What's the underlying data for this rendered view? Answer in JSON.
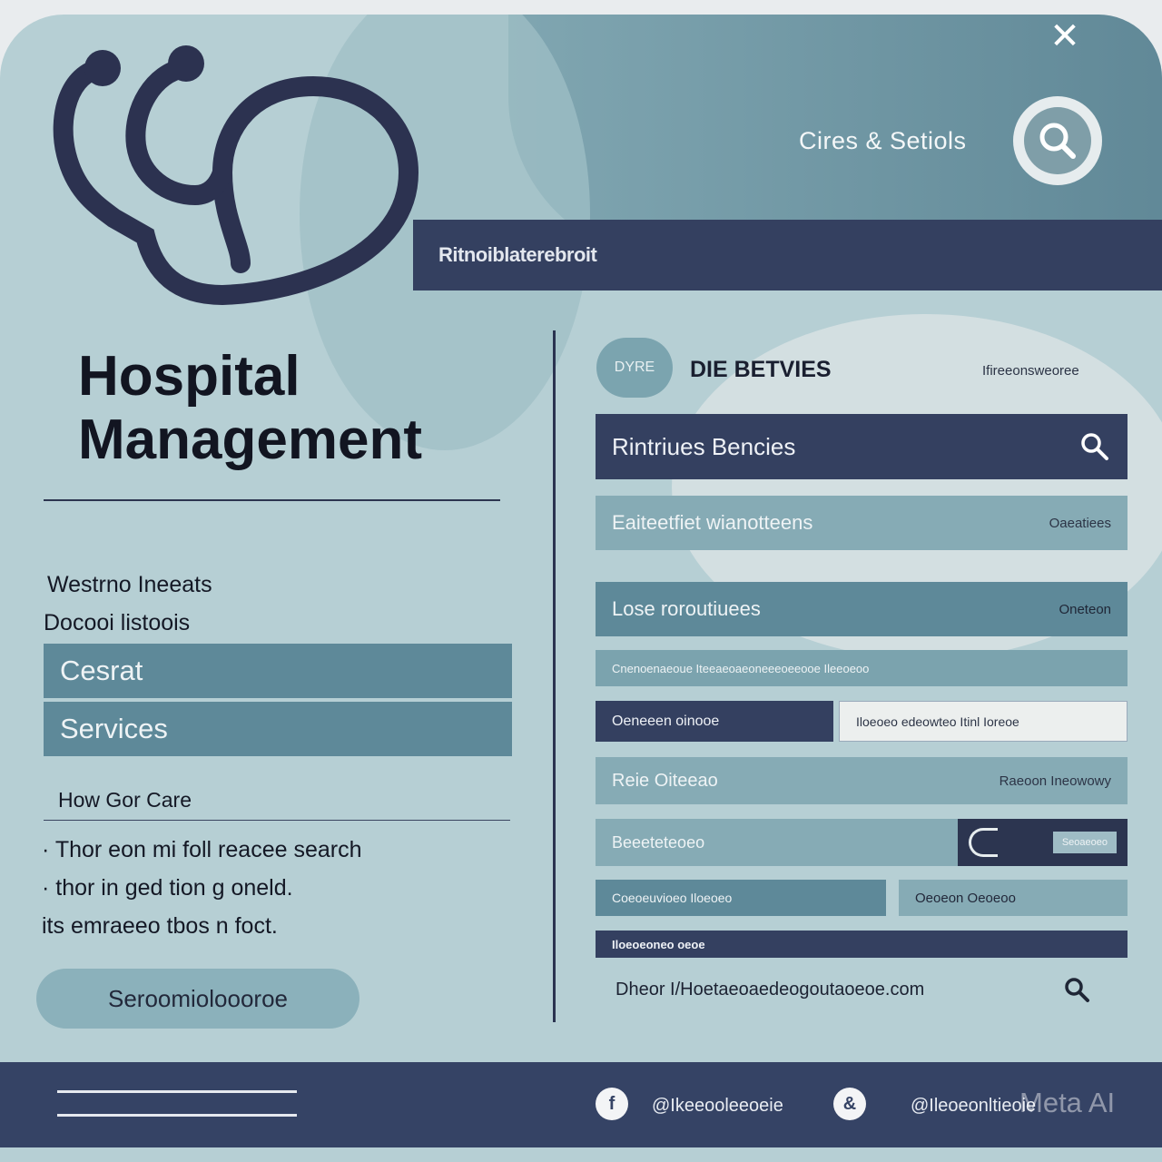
{
  "header": {
    "nav_link": "Cires & Setiols",
    "banner_text": "Ritnoiblaterebroit"
  },
  "left": {
    "title_line1": "Hospital",
    "title_line2": "Management",
    "subtitle1": "Westrno Ineeats",
    "subtitle2": "Docooi listoois",
    "menu": [
      "Cesrat",
      "Services"
    ],
    "section_label": "How Gor Care",
    "body_lines": [
      "· Thor eon mi foll reacee search",
      "· thor in ged tion g oneld.",
      "its emraeeo tbos n foct."
    ],
    "cta": "Seroomioloooroe"
  },
  "right": {
    "tag_badge": "DYRE",
    "tag_label": "DIE BETVIES",
    "tag_note": "Ifireeonsweoree",
    "search_bar": "Rintriues Bencies",
    "row1": {
      "left": "Eaiteetfiet wianotteens",
      "right": "Oaeatiees"
    },
    "row2": {
      "left": "Lose roroutiuees",
      "right": "Oneteon"
    },
    "row3": {
      "left": "Cnenoenaeoue Iteeaeoaeoneeeoeeooe Ileeoeoo"
    },
    "row4": {
      "left": "Oeneeen oinooe",
      "right": "Iloeoeo edeowteo Itinl Ioreoe"
    },
    "row5": {
      "left": "Reie Oiteeao",
      "right": "Raeoon Ineowowy"
    },
    "row6": {
      "left": "Beeeteteoeo",
      "right": "Seoaeoeo"
    },
    "row7": {
      "left": "Coeoeuvioeo Iloeoeo",
      "right": "Oeoeon Oeoeoo"
    },
    "row8": {
      "left": "Iloeoeoneo oeoe"
    },
    "url_row": "Dheor I/Hoetaeoaedeogoutaoeoe.com"
  },
  "footer": {
    "handle1": "@Ikeeooleeoeie",
    "handle2": "@Ileoeonltieoie",
    "watermark": "Meta AI"
  }
}
